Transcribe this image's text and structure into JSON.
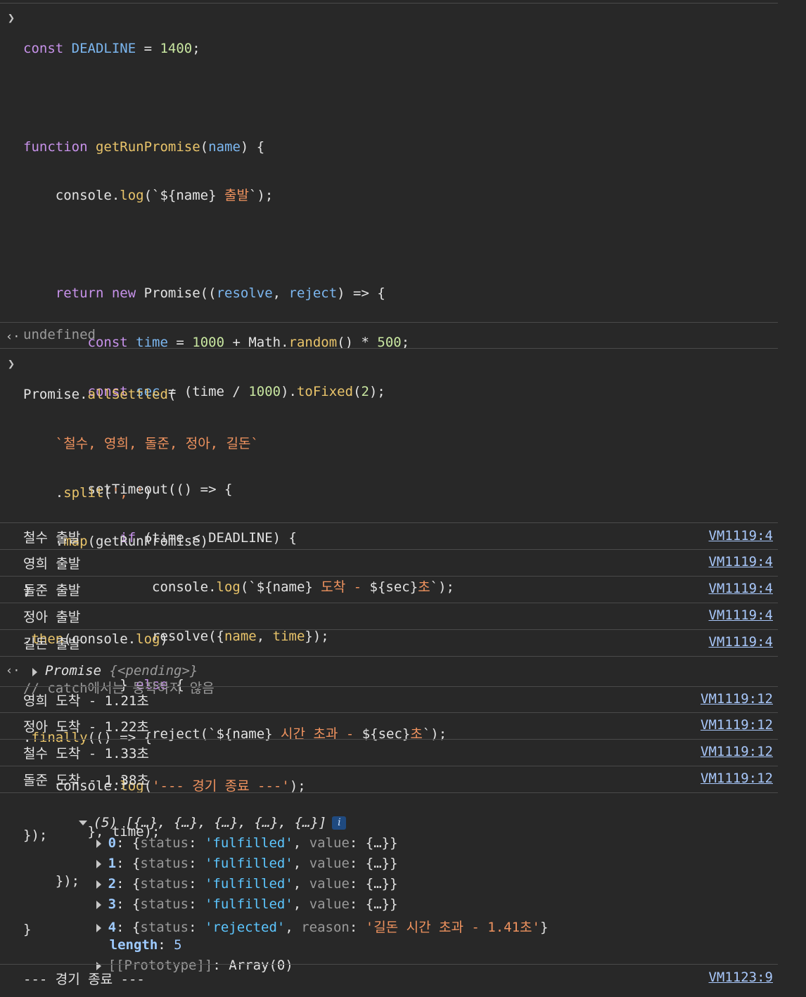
{
  "code_block_1": {
    "lines": [
      [
        "const ",
        "DEADLINE",
        " = ",
        "1400",
        ";"
      ],
      [
        ""
      ],
      [
        "function ",
        "getRunPromise",
        "(",
        "name",
        ") {"
      ],
      [
        "    console.",
        "log",
        "(`${name} ",
        "출발",
        "`);"
      ],
      [
        ""
      ],
      [
        "    ",
        "return ",
        "new ",
        "Promise((",
        "resolve",
        ", ",
        "reject",
        ") => {"
      ],
      [
        "        ",
        "const ",
        "time",
        " = ",
        "1000",
        " + Math.",
        "random",
        "() * ",
        "500",
        ";"
      ],
      [
        "        ",
        "const ",
        "sec",
        " = (time / ",
        "1000",
        ").",
        "toFixed",
        "(",
        "2",
        ");"
      ],
      [
        ""
      ],
      [
        "        setTimeout(() => {"
      ],
      [
        "            ",
        "if",
        " (time < DEADLINE) {"
      ],
      [
        "                console.",
        "log",
        "(`${name} ",
        "도착 - ",
        "${sec}",
        "초",
        "`);"
      ],
      [
        "                resolve({",
        "name",
        ", ",
        "time",
        "});"
      ],
      [
        "            } ",
        "else",
        " {"
      ],
      [
        "                reject(`${name} ",
        "시간 초과 - ",
        "${sec}",
        "초",
        "`);"
      ],
      [
        "            }"
      ],
      [
        "        }, time);"
      ],
      [
        "    });"
      ],
      [
        "}"
      ]
    ]
  },
  "result_1": "undefined",
  "code_block_2": {
    "lines": [
      [
        "Promise.",
        "allSettled",
        "("
      ],
      [
        "    ",
        "`철수, 영희, 돌준, 정아, 길돈`"
      ],
      [
        "    .",
        "split",
        "(",
        "', '",
        ")"
      ],
      [
        "    .",
        "map",
        "(getRunPromise)"
      ],
      [
        ")"
      ],
      [
        ".",
        "then",
        "(console.",
        "log",
        ")"
      ],
      [
        "// catch에서는 동작하지 않음"
      ],
      [
        ".",
        "finally",
        "(() => {"
      ],
      [
        "    console.",
        "log",
        "(",
        "'--- 경기 종료 ---'",
        ");"
      ],
      [
        "});"
      ]
    ]
  },
  "log_rows_start": [
    {
      "text": "철수 출발",
      "source": "VM1119:4"
    },
    {
      "text": "영희 출발",
      "source": "VM1119:4"
    },
    {
      "text": "돌준 출발",
      "source": "VM1119:4"
    },
    {
      "text": "정아 출발",
      "source": "VM1119:4"
    },
    {
      "text": "길돈 출발",
      "source": "VM1119:4"
    }
  ],
  "promise_result": {
    "label": "Promise",
    "state": "{<pending>}"
  },
  "log_rows_arrive": [
    {
      "text": "영희 도착 - 1.21초",
      "source": "VM1119:12"
    },
    {
      "text": "정아 도착 - 1.22초",
      "source": "VM1119:12"
    },
    {
      "text": "철수 도착 - 1.33초",
      "source": "VM1119:12"
    },
    {
      "text": "돌준 도착 - 1.38초",
      "source": "VM1119:12"
    }
  ],
  "array_output": {
    "summary": "(5) [{…}, {…}, {…}, {…}, {…}]",
    "info_icon": "i",
    "items": [
      {
        "index": "0",
        "status": "'fulfilled'",
        "second_key": "value",
        "second_val": "{…}"
      },
      {
        "index": "1",
        "status": "'fulfilled'",
        "second_key": "value",
        "second_val": "{…}"
      },
      {
        "index": "2",
        "status": "'fulfilled'",
        "second_key": "value",
        "second_val": "{…}"
      },
      {
        "index": "3",
        "status": "'fulfilled'",
        "second_key": "value",
        "second_val": "{…}"
      },
      {
        "index": "4",
        "status": "'rejected'",
        "second_key": "reason",
        "second_val": "'길돈 시간 초과 - 1.41초'"
      }
    ],
    "length_key": "length",
    "length_val": "5",
    "proto_key": "[[Prototype]]",
    "proto_val": "Array(0)"
  },
  "final_log": {
    "text": "--- 경기 종료 ---",
    "source": "VM1123:9"
  },
  "colors": {
    "background": "#282828",
    "separator": "#4a4a4a",
    "link": "#a8c7fa",
    "keyword": "#c792ea",
    "string": "#f0935f"
  }
}
